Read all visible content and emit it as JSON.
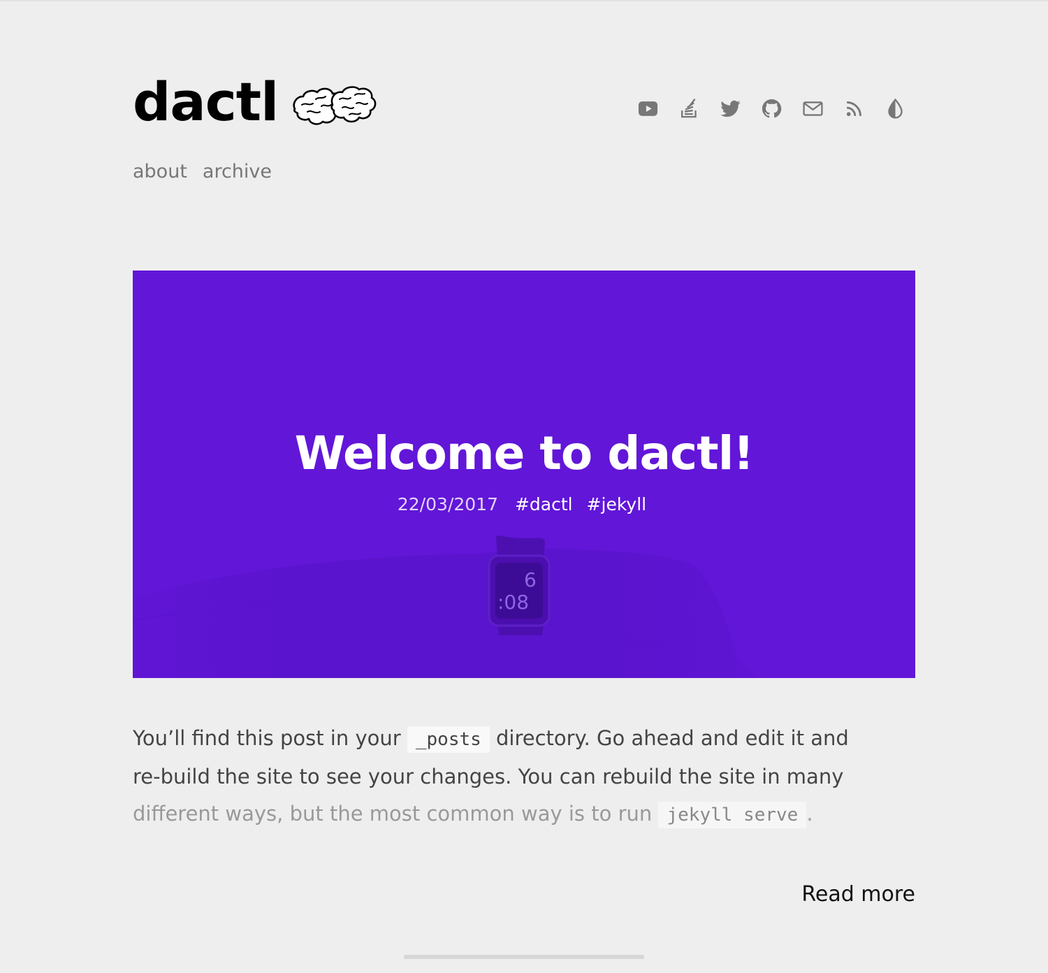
{
  "site": {
    "title": "dactl",
    "logo_icon": "brain-icon"
  },
  "social": [
    {
      "icon": "youtube-icon"
    },
    {
      "icon": "stack-overflow-icon"
    },
    {
      "icon": "twitter-icon"
    },
    {
      "icon": "github-icon"
    },
    {
      "icon": "mail-icon"
    },
    {
      "icon": "rss-icon"
    },
    {
      "icon": "theme-toggle-icon"
    }
  ],
  "nav": {
    "items": [
      "about",
      "archive"
    ]
  },
  "post": {
    "title": "Welcome to dactl!",
    "date": "22/03/2017",
    "tags": [
      "#dactl",
      "#jekyll"
    ],
    "hero_color": "#6216d8",
    "watch_time_hour": "6",
    "watch_time_min": ":08",
    "excerpt": {
      "part1": "You’ll find this post in your ",
      "code1": "_posts",
      "part2": " directory. Go ahead and edit it and",
      "line2": "re-build the site to see your changes. You can rebuild the site in many",
      "line3": "different ways, but the most common way is to run ",
      "code2": "jekyll serve",
      "part3": "."
    },
    "read_more": "Read more"
  },
  "colors": {
    "background": "#eeeeee",
    "accent": "#6216d8",
    "icon": "#777777"
  }
}
